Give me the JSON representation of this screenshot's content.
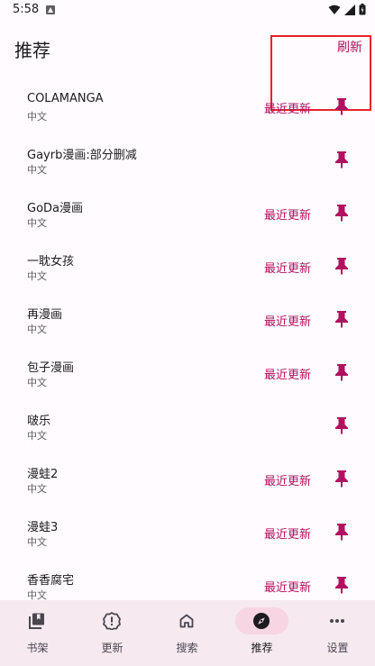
{
  "status_bar": {
    "time": "5:58"
  },
  "app_bar": {
    "title": "推荐",
    "refresh_label": "刷新"
  },
  "sources": [
    {
      "name": "COLAMANGA",
      "lang": "中文",
      "latest": "最近更新"
    },
    {
      "name": "Gayrb漫画:部分删减",
      "lang": "中文",
      "latest": ""
    },
    {
      "name": "GoDa漫画",
      "lang": "中文",
      "latest": "最近更新"
    },
    {
      "name": "一耽女孩",
      "lang": "中文",
      "latest": "最近更新"
    },
    {
      "name": "再漫画",
      "lang": "中文",
      "latest": "最近更新"
    },
    {
      "name": "包子漫画",
      "lang": "中文",
      "latest": "最近更新"
    },
    {
      "name": "啵乐",
      "lang": "中文",
      "latest": ""
    },
    {
      "name": "漫蛙2",
      "lang": "中文",
      "latest": "最近更新"
    },
    {
      "name": "漫蛙3",
      "lang": "中文",
      "latest": "最近更新"
    },
    {
      "name": "香香腐宅",
      "lang": "中文",
      "latest": "最近更新"
    }
  ],
  "bottom_nav": {
    "items": [
      {
        "label": "书架",
        "icon": "library-icon",
        "active": false
      },
      {
        "label": "更新",
        "icon": "alert-circle-icon",
        "active": false
      },
      {
        "label": "搜索",
        "icon": "home-icon",
        "active": false
      },
      {
        "label": "推荐",
        "icon": "compass-icon",
        "active": true
      },
      {
        "label": "设置",
        "icon": "more-icon",
        "active": false
      }
    ]
  },
  "colors": {
    "accent": "#b0125f",
    "nav_background": "#f6e9f0",
    "nav_active_indicator": "#f7d5e2",
    "highlight_box": "#e8222a"
  }
}
